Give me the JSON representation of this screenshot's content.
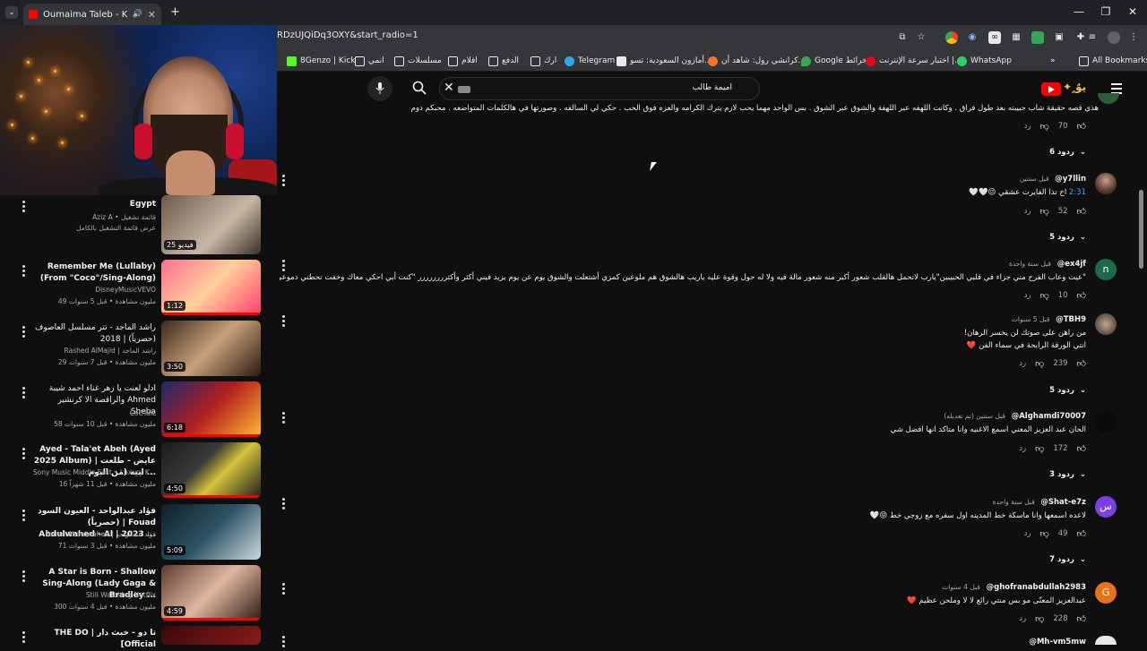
{
  "browser": {
    "tab_title": "Oumaima Taleb - Kol Leila",
    "url": "RDzUJQiDq3OXY&start_radio=1",
    "bookmarks": [
      "8Genzo | Kick",
      "انمي",
      "مسلسلات",
      "افلام",
      "الدفع",
      "ارك",
      "Telegram",
      "أمازون السعودية: تسو...",
      "كرانشي رول: شاهد أن...",
      "Google خرائط",
      "اختبار سرعة الإنترنت |...",
      "WhatsApp"
    ],
    "all_bookmarks": "All Bookmarks"
  },
  "youtube": {
    "search_value": "اميمة طالب"
  },
  "playlist": [
    {
      "title": "Egypt",
      "channel": "Aziz A • قائمة تشغيل",
      "meta": "عرض قائمة التشغيل بالكامل",
      "duration": "25 فيديو"
    },
    {
      "title": "Remember Me (Lullaby) (From \"Coco\"/Sing-Along)",
      "channel": "DisneyMusicVEVO",
      "meta": "49 مليون مشاهدة • قبل 5 سنوات",
      "duration": "1:12"
    },
    {
      "title": "راشد الماجد - تتر مسلسل العاصوف (حصرياً) | 2018",
      "channel": "Rashed AlMajid | راشد الماجد",
      "meta": "29 مليون مشاهدة • قبل 7 سنوات",
      "duration": "3:50"
    },
    {
      "title": "ادلو لعنت يا زهر غناء احمد شيبة والراقصة الا كرنشير Ahmed Sheba",
      "channel": "CoCTaiL",
      "meta": "58 مليون مشاهدة • قبل 10 سنوات",
      "duration": "6:18"
    },
    {
      "title": "Ayed - Tala'et Abeh (Ayed 2025 Album) | عايض - طلعت ابيه (من البوم ...",
      "channel": "Sony Music Middle East • Luxury K...",
      "meta": "16 مليون مشاهدة • قبل 11 شهراً",
      "duration": "4:50"
    },
    {
      "title": "فؤاد عبدالواحد - العيون السود (حصرياً) | Fouad Abdulwahed - Al | 2023 ...",
      "channel": "Fouad Abdulwahed | فؤاد عبدالواحد",
      "meta": "71 مليون مشاهدة • قبل 3 سنوات",
      "duration": "5:09"
    },
    {
      "title": "A Star is Born - Shallow Sing-Along (Lady Gaga & Bradley ...",
      "channel": "Still Watching Netflix",
      "meta": "300 مليون مشاهدة • قبل 4 سنوات",
      "duration": "4:59"
    },
    {
      "title": "THE DO | تا دو - خبث دار [Official",
      "channel": "",
      "meta": "",
      "duration": ""
    }
  ],
  "comments": {
    "top_partial": {
      "text": "هذي قصه حقيقة شاب حبيبته بعد طول فراق . وكانت اللهفه عبر اللهفة والشوق عبر الشوق . بس الواحد مهما يحب لازم يترك الكرامه والعزه فوق الحب . حكي لي السالفه . وصورتها في هالكلمات المتواضعه . محبكم دوم",
      "likes": "70",
      "reply": "رد",
      "replies": "6 ردود"
    },
    "items": [
      {
        "user": "@y7llin",
        "time": "قبل سنتين",
        "text_ts": "2:31",
        "text": "اخ تذا الفايرت عشقي 😔🤍🤍",
        "likes": "52",
        "reply": "رد",
        "replies": "5 ردود",
        "avatar": "photo"
      },
      {
        "user": "@ex4jf",
        "time": "قبل سنة واحدة",
        "text": "\"عيت وعاب الفرح مني جزاء في قلبي الحبيبين\"يارب لاتحمل هالقلب شعور أكبر منه شعور مالة فيه ولا له حول وقوة عليه ياريب هالشوق هم ملوعين كمزي أشتعلت والشوق يوم عن يوم يزيد فيني أكثر وأكثرررررررر \"كنت أبي احكي معاك وخفت تحطني دموعي\" وتخليني دموعي مع كل الأسف ..",
        "likes": "10",
        "reply": "رد",
        "replies": "",
        "avatar": "n"
      },
      {
        "user": "@TBH9",
        "time": "قبل 5 سنوات",
        "text": "من راهن على صوتك لن يخسر الرهان!\nانتي الورقة الرابحة في سماء الفن ❤️",
        "likes": "239",
        "reply": "رد",
        "replies": "5 ردود",
        "avatar": "photo"
      },
      {
        "user": "@Alghamdi70007",
        "time": "قبل سنتين (تم تعديله)",
        "text": "الحان عبد العزيز المعني اسمع الاغنيه وانا متاكد انها افضل شي",
        "likes": "172",
        "reply": "رد",
        "replies": "3 ردود",
        "avatar": "dark"
      },
      {
        "user": "@Shat-e7z",
        "time": "قبل سنة واحدة",
        "text": "لاعده اسمعها وانا ماسكة خط المدينه اول سفره مع زوجي خط 😝🤍",
        "likes": "49",
        "reply": "رد",
        "replies": "7 ردود",
        "avatar": "س"
      },
      {
        "user": "@ghofranabdullah2983",
        "time": "قبل 4 سنوات",
        "text": "عبدالعزيز المعنّى مو بس منتي رائع لا لا وملحن عظيم ❤️",
        "likes": "228",
        "reply": "رد",
        "replies": "",
        "avatar": "G"
      }
    ],
    "bottom_partial_user": "@Mh-vm5mw"
  }
}
